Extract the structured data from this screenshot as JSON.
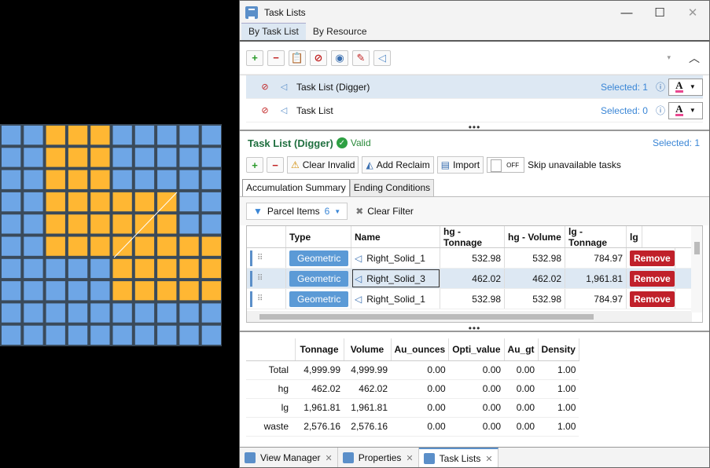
{
  "window": {
    "title": "Task Lists",
    "min_icon": "minimize-icon",
    "max_icon": "maximize-icon",
    "close_icon": "close-icon"
  },
  "top_tabs": [
    {
      "label": "By Task List"
    },
    {
      "label": "By Resource"
    }
  ],
  "task_lists": [
    {
      "name": "Task List (Digger)",
      "selected": "Selected: 1",
      "color_letter": "A"
    },
    {
      "name": "Task List",
      "selected": "Selected: 0",
      "color_letter": "A"
    }
  ],
  "task": {
    "name": "Task List (Digger)",
    "status": "Valid",
    "selected": "Selected: 1"
  },
  "toolbar2": {
    "clear_invalid": "Clear Invalid",
    "add_reclaim": "Add Reclaim",
    "import": "Import",
    "toggle": "OFF",
    "skip": "Skip unavailable tasks"
  },
  "tabs2": [
    {
      "label": "Accumulation Summary"
    },
    {
      "label": "Ending Conditions"
    }
  ],
  "filter": {
    "label": "Parcel Items",
    "count": "6",
    "clear": "Clear Filter"
  },
  "grid": {
    "headers": [
      "Type",
      "Name",
      "hg - Tonnage",
      "hg - Volume",
      "lg - Tonnage",
      "lg"
    ],
    "rows": [
      {
        "type": "Geometric",
        "name": "Right_Solid_1",
        "a": "532.98",
        "b": "532.98",
        "c": "784.97",
        "action": "Remove"
      },
      {
        "type": "Geometric",
        "name": "Right_Solid_3",
        "a": "462.02",
        "b": "462.02",
        "c": "1,961.81",
        "action": "Remove"
      },
      {
        "type": "Geometric",
        "name": "Right_Solid_1",
        "a": "532.98",
        "b": "532.98",
        "c": "784.97",
        "action": "Remove"
      }
    ]
  },
  "summary": {
    "headers": [
      "Tonnage",
      "Volume",
      "Au_ounces",
      "Opti_value",
      "Au_gt",
      "Density"
    ],
    "rows": [
      {
        "label": "Total",
        "v": [
          "4,999.99",
          "4,999.99",
          "0.00",
          "0.00",
          "0.00",
          "1.00"
        ]
      },
      {
        "label": "hg",
        "v": [
          "462.02",
          "462.02",
          "0.00",
          "0.00",
          "0.00",
          "1.00"
        ]
      },
      {
        "label": "lg",
        "v": [
          "1,961.81",
          "1,961.81",
          "0.00",
          "0.00",
          "0.00",
          "1.00"
        ]
      },
      {
        "label": "waste",
        "v": [
          "2,576.16",
          "2,576.16",
          "0.00",
          "0.00",
          "0.00",
          "1.00"
        ]
      }
    ]
  },
  "bottom_tabs": [
    {
      "label": "View Manager"
    },
    {
      "label": "Properties"
    },
    {
      "label": "Task Lists"
    }
  ],
  "colors": {
    "blue_block": "#6ea6e6",
    "orange_block": "#ffb733",
    "accent": "#3a86d6",
    "remove": "#c0202a",
    "geometric": "#5b9ad6"
  }
}
